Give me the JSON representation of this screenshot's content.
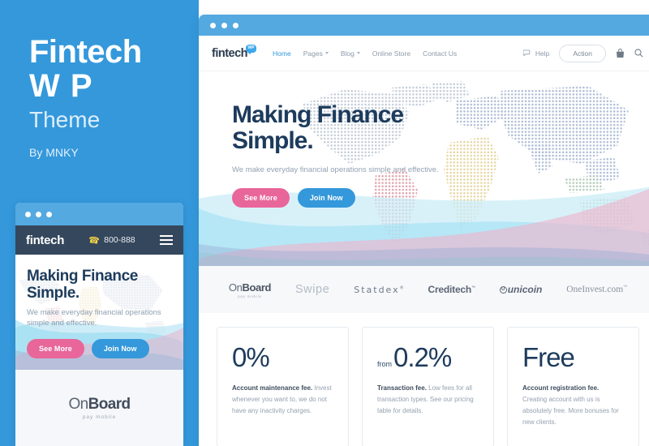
{
  "promo": {
    "line1": "Fintech",
    "line2": "W P",
    "line3": "Theme",
    "byline": "By MNKY"
  },
  "colors": {
    "panel_blue": "#3498db",
    "chrome_blue": "#54a9e0",
    "mobile_nav_dark": "#35475c",
    "heading_navy": "#1d3b5c",
    "accent_pink": "#e8669a",
    "accent_blue": "#3498db",
    "phone_yellow": "#f5d547",
    "logo_strip_bg": "#f6f8fa"
  },
  "mobile": {
    "logo": "fintech",
    "phone": "800-888",
    "phone_icon": "phone-icon",
    "menu_icon": "hamburger-menu-icon",
    "heading": "Making Finance Simple.",
    "subheading": "We make everyday financial operations simple and effective.",
    "buttons": [
      {
        "label": "See More",
        "style": "pink"
      },
      {
        "label": "Join Now",
        "style": "blue"
      }
    ],
    "footer_brand": {
      "pre": "On",
      "bold": "Board",
      "sub": "pay mobile"
    }
  },
  "desktop": {
    "logo": {
      "text": "fintech",
      "badge": "WP"
    },
    "nav": [
      {
        "label": "Home",
        "active": true,
        "caret": false
      },
      {
        "label": "Pages",
        "active": false,
        "caret": true
      },
      {
        "label": "Blog",
        "active": false,
        "caret": true
      },
      {
        "label": "Online Store",
        "active": false,
        "caret": false
      },
      {
        "label": "Contact Us",
        "active": false,
        "caret": false
      }
    ],
    "help_label": "Help",
    "help_icon": "chat-bubble-icon",
    "action_label": "Action",
    "cart_icon": "shopping-bag-icon",
    "search_icon": "search-icon",
    "hero": {
      "heading_line1": "Making Finance",
      "heading_line2": "Simple.",
      "subheading": "We make everyday financial operations simple and effective.",
      "buttons": [
        {
          "label": "See More",
          "style": "pink"
        },
        {
          "label": "Join Now",
          "style": "blue"
        }
      ]
    },
    "brands": [
      {
        "name": "OnBoard",
        "pre": "On",
        "bold": "Board",
        "sub": "pay mobile"
      },
      {
        "name": "Swipe",
        "text": "Swipe"
      },
      {
        "name": "Statdex",
        "text": "Statdex",
        "mark": "®"
      },
      {
        "name": "Creditech",
        "text": "Creditech",
        "mark": "™"
      },
      {
        "name": "unicoin",
        "text": "unicoin",
        "glyph": "●"
      },
      {
        "name": "OneInvest.com",
        "text": "OneInvest.com",
        "mark": "™"
      }
    ],
    "cards": [
      {
        "prefix": "",
        "value": "0%",
        "title": "Account maintenance fee.",
        "body": " Invest whenever you want to, we do not have any inactivity charges."
      },
      {
        "prefix": "from",
        "value": "0.2%",
        "title": "Transaction fee.",
        "body": " Low fees for all transaction types. See our pricing table for details."
      },
      {
        "prefix": "",
        "value": "Free",
        "title": "Account registration fee.",
        "body": " Creating account with us is absolutely free. More bonuses for new clients."
      }
    ]
  }
}
